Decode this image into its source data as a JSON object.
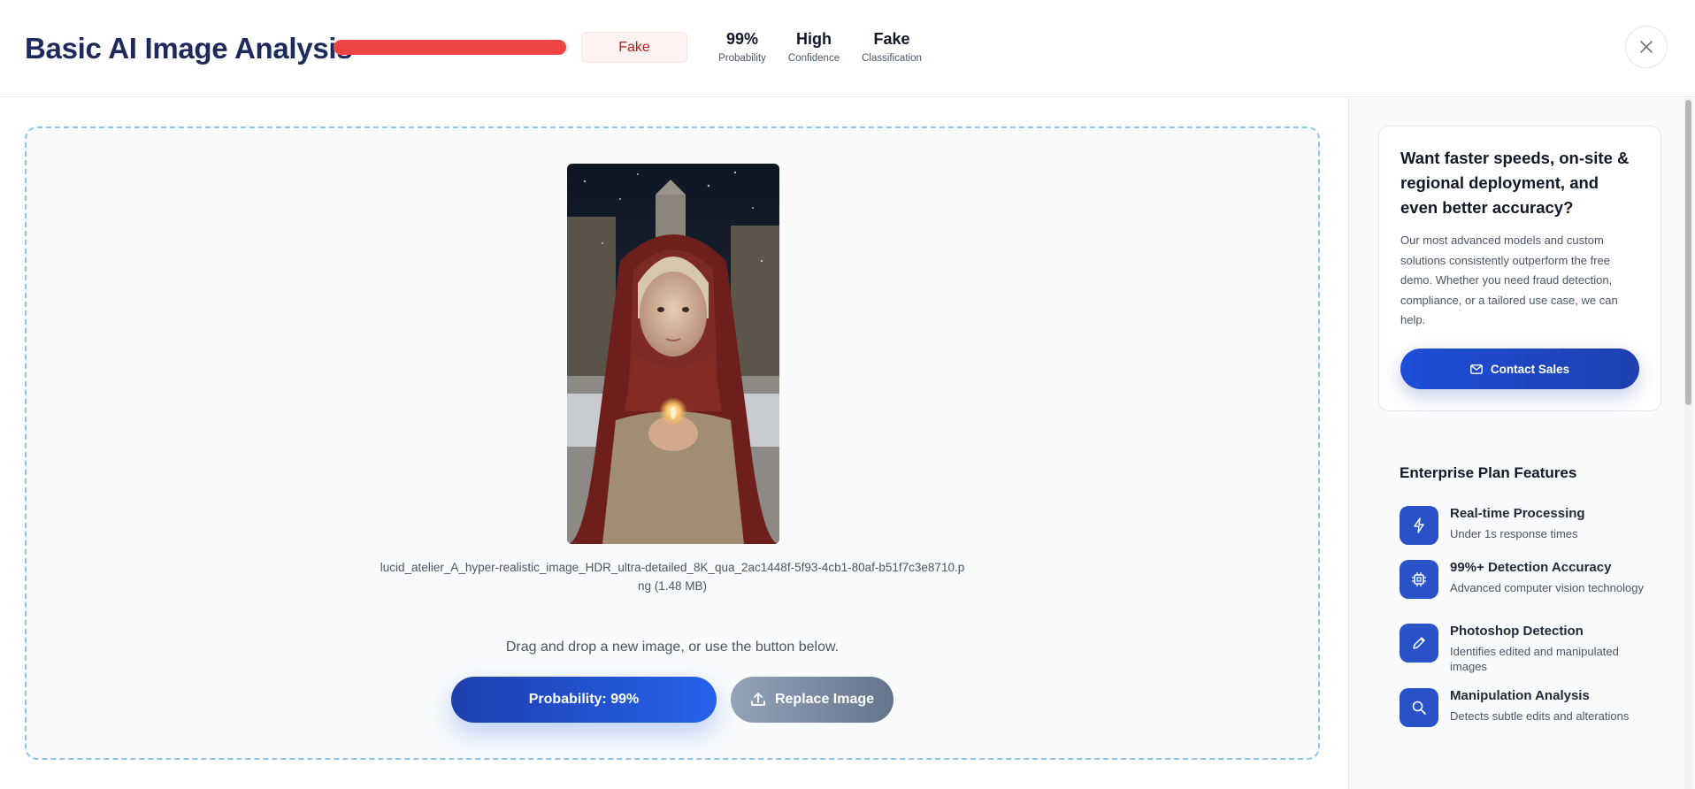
{
  "header": {
    "title": "Basic AI Image Analysis",
    "probability_fraction": 0.99,
    "bar_color": "#ef4444",
    "badge": "Fake",
    "stats": [
      {
        "value": "99%",
        "label": "Probability"
      },
      {
        "value": "High",
        "label": "Confidence"
      },
      {
        "value": "Fake",
        "label": "Classification"
      }
    ],
    "close_icon": "close-icon"
  },
  "upload": {
    "filename_line1": "lucid_atelier_A_hyper-realistic_image_HDR_ultra-detailed_8K_qua_2ac1448f-5f93-4cb1-80af-b51f7c3e8710.p",
    "filename_line2": "ng (1.48 MB)",
    "hint": "Drag and drop a new image, or use the button below.",
    "probability_button": "Probability: 99%",
    "replace_button": "Replace Image"
  },
  "sidebar": {
    "promo_title": "Want faster speeds, on-site & regional deployment, and even better accuracy?",
    "promo_text": "Our most advanced models and custom solutions consistently outperform the free demo. Whether you need fraud detection, compliance, or a tailored use case, we can help.",
    "contact_button": "Contact Sales",
    "features_title": "Enterprise Plan Features",
    "features": [
      {
        "title": "Real-time Processing",
        "desc": "Under 1s response times",
        "icon": "lightning-icon"
      },
      {
        "title": "99%+ Detection Accuracy",
        "desc": "Advanced computer vision technology",
        "icon": "chip-icon"
      },
      {
        "title": "Photoshop Detection",
        "desc": "Identifies edited and manipulated images",
        "icon": "pencil-icon"
      },
      {
        "title": "Manipulation Analysis",
        "desc": "Detects subtle edits and alterations",
        "icon": "magnifier-icon"
      }
    ]
  },
  "colors": {
    "accent": "#1e40af",
    "fake_red": "#ef4444",
    "title_navy": "#1e2a5c"
  }
}
